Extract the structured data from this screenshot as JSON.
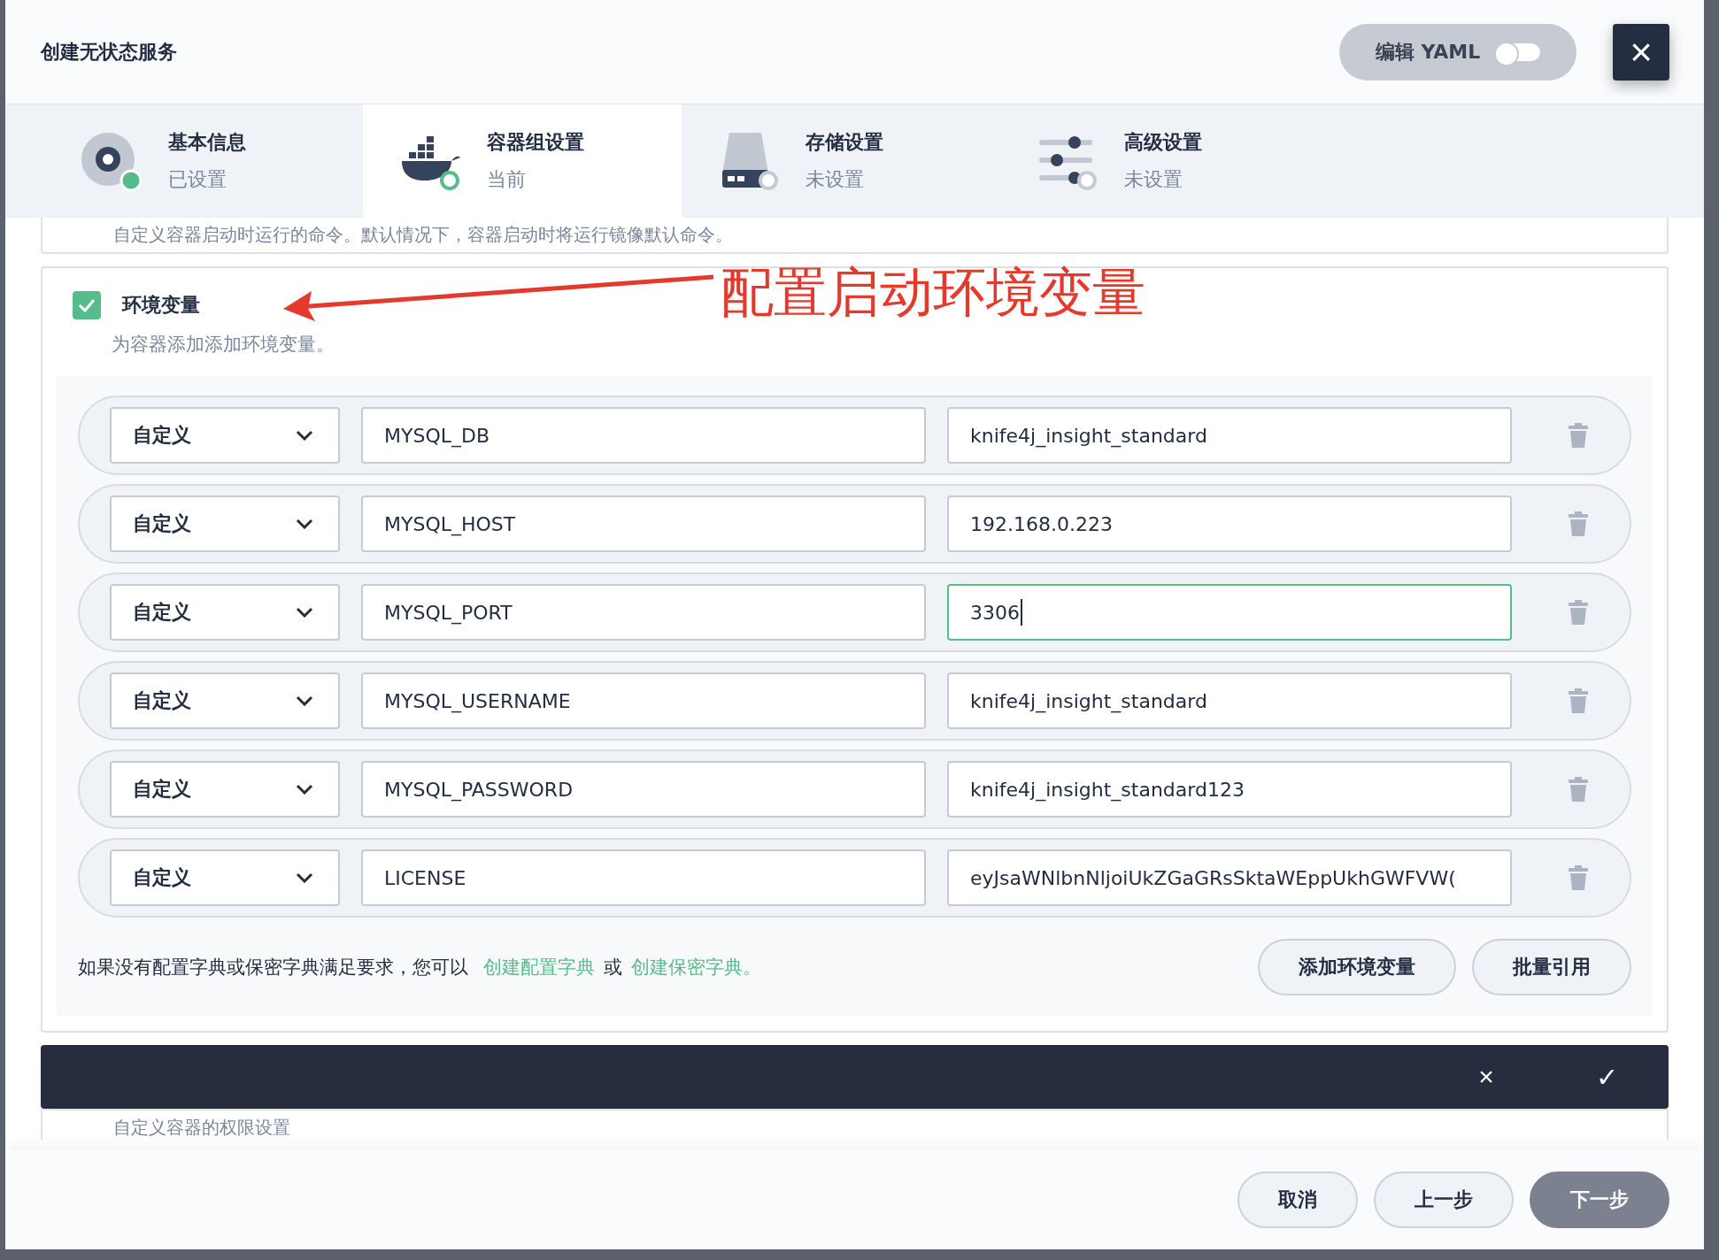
{
  "dialog": {
    "title": "创建无状态服务",
    "yaml_toggle": {
      "label": "编辑 YAML",
      "on": false
    },
    "close": "×"
  },
  "steps": [
    {
      "kind": "info",
      "title": "基本信息",
      "status": "已设置",
      "done": true,
      "selected": false
    },
    {
      "kind": "docker",
      "title": "容器组设置",
      "status": "当前",
      "done": false,
      "selected": true
    },
    {
      "kind": "disk",
      "title": "存储设置",
      "status": "未设置",
      "done": false,
      "selected": false
    },
    {
      "kind": "sliders",
      "title": "高级设置",
      "status": "未设置",
      "done": false,
      "selected": false
    }
  ],
  "command_hint": "自定义容器启动时运行的命令。默认情况下，容器启动时将运行镜像默认命令。",
  "env": {
    "checked": true,
    "title": "环境变量",
    "description": "为容器添加添加环境变量。",
    "rows": [
      {
        "type": "自定义",
        "name": "MYSQL_DB",
        "value": "knife4j_insight_standard",
        "focused": false
      },
      {
        "type": "自定义",
        "name": "MYSQL_HOST",
        "value": "192.168.0.223",
        "focused": false
      },
      {
        "type": "自定义",
        "name": "MYSQL_PORT",
        "value": "3306",
        "focused": true
      },
      {
        "type": "自定义",
        "name": "MYSQL_USERNAME",
        "value": "knife4j_insight_standard",
        "focused": false
      },
      {
        "type": "自定义",
        "name": "MYSQL_PASSWORD",
        "value": "knife4j_insight_standard123",
        "focused": false
      },
      {
        "type": "自定义",
        "name": "LICENSE",
        "value": "eyJsaWNlbnNljoiUkZGaGRsSktaWEppUkhGWFVW(",
        "focused": false
      }
    ],
    "footer_text": "如果没有配置字典或保密字典满足要求，您可以",
    "link_config": "创建配置字典",
    "or": "或",
    "link_secret": "创建保密字典。",
    "buttons": [
      "添加环境变量",
      "批量引用"
    ]
  },
  "annotation": "配置启动环境变量",
  "action_bar": {
    "cancel": "×",
    "confirm": "✓"
  },
  "permission_hint": "自定义容器的权限设置",
  "footer_buttons": [
    {
      "label": "取消",
      "primary": false
    },
    {
      "label": "上一步",
      "primary": false
    },
    {
      "label": "下一步",
      "primary": true
    }
  ]
}
